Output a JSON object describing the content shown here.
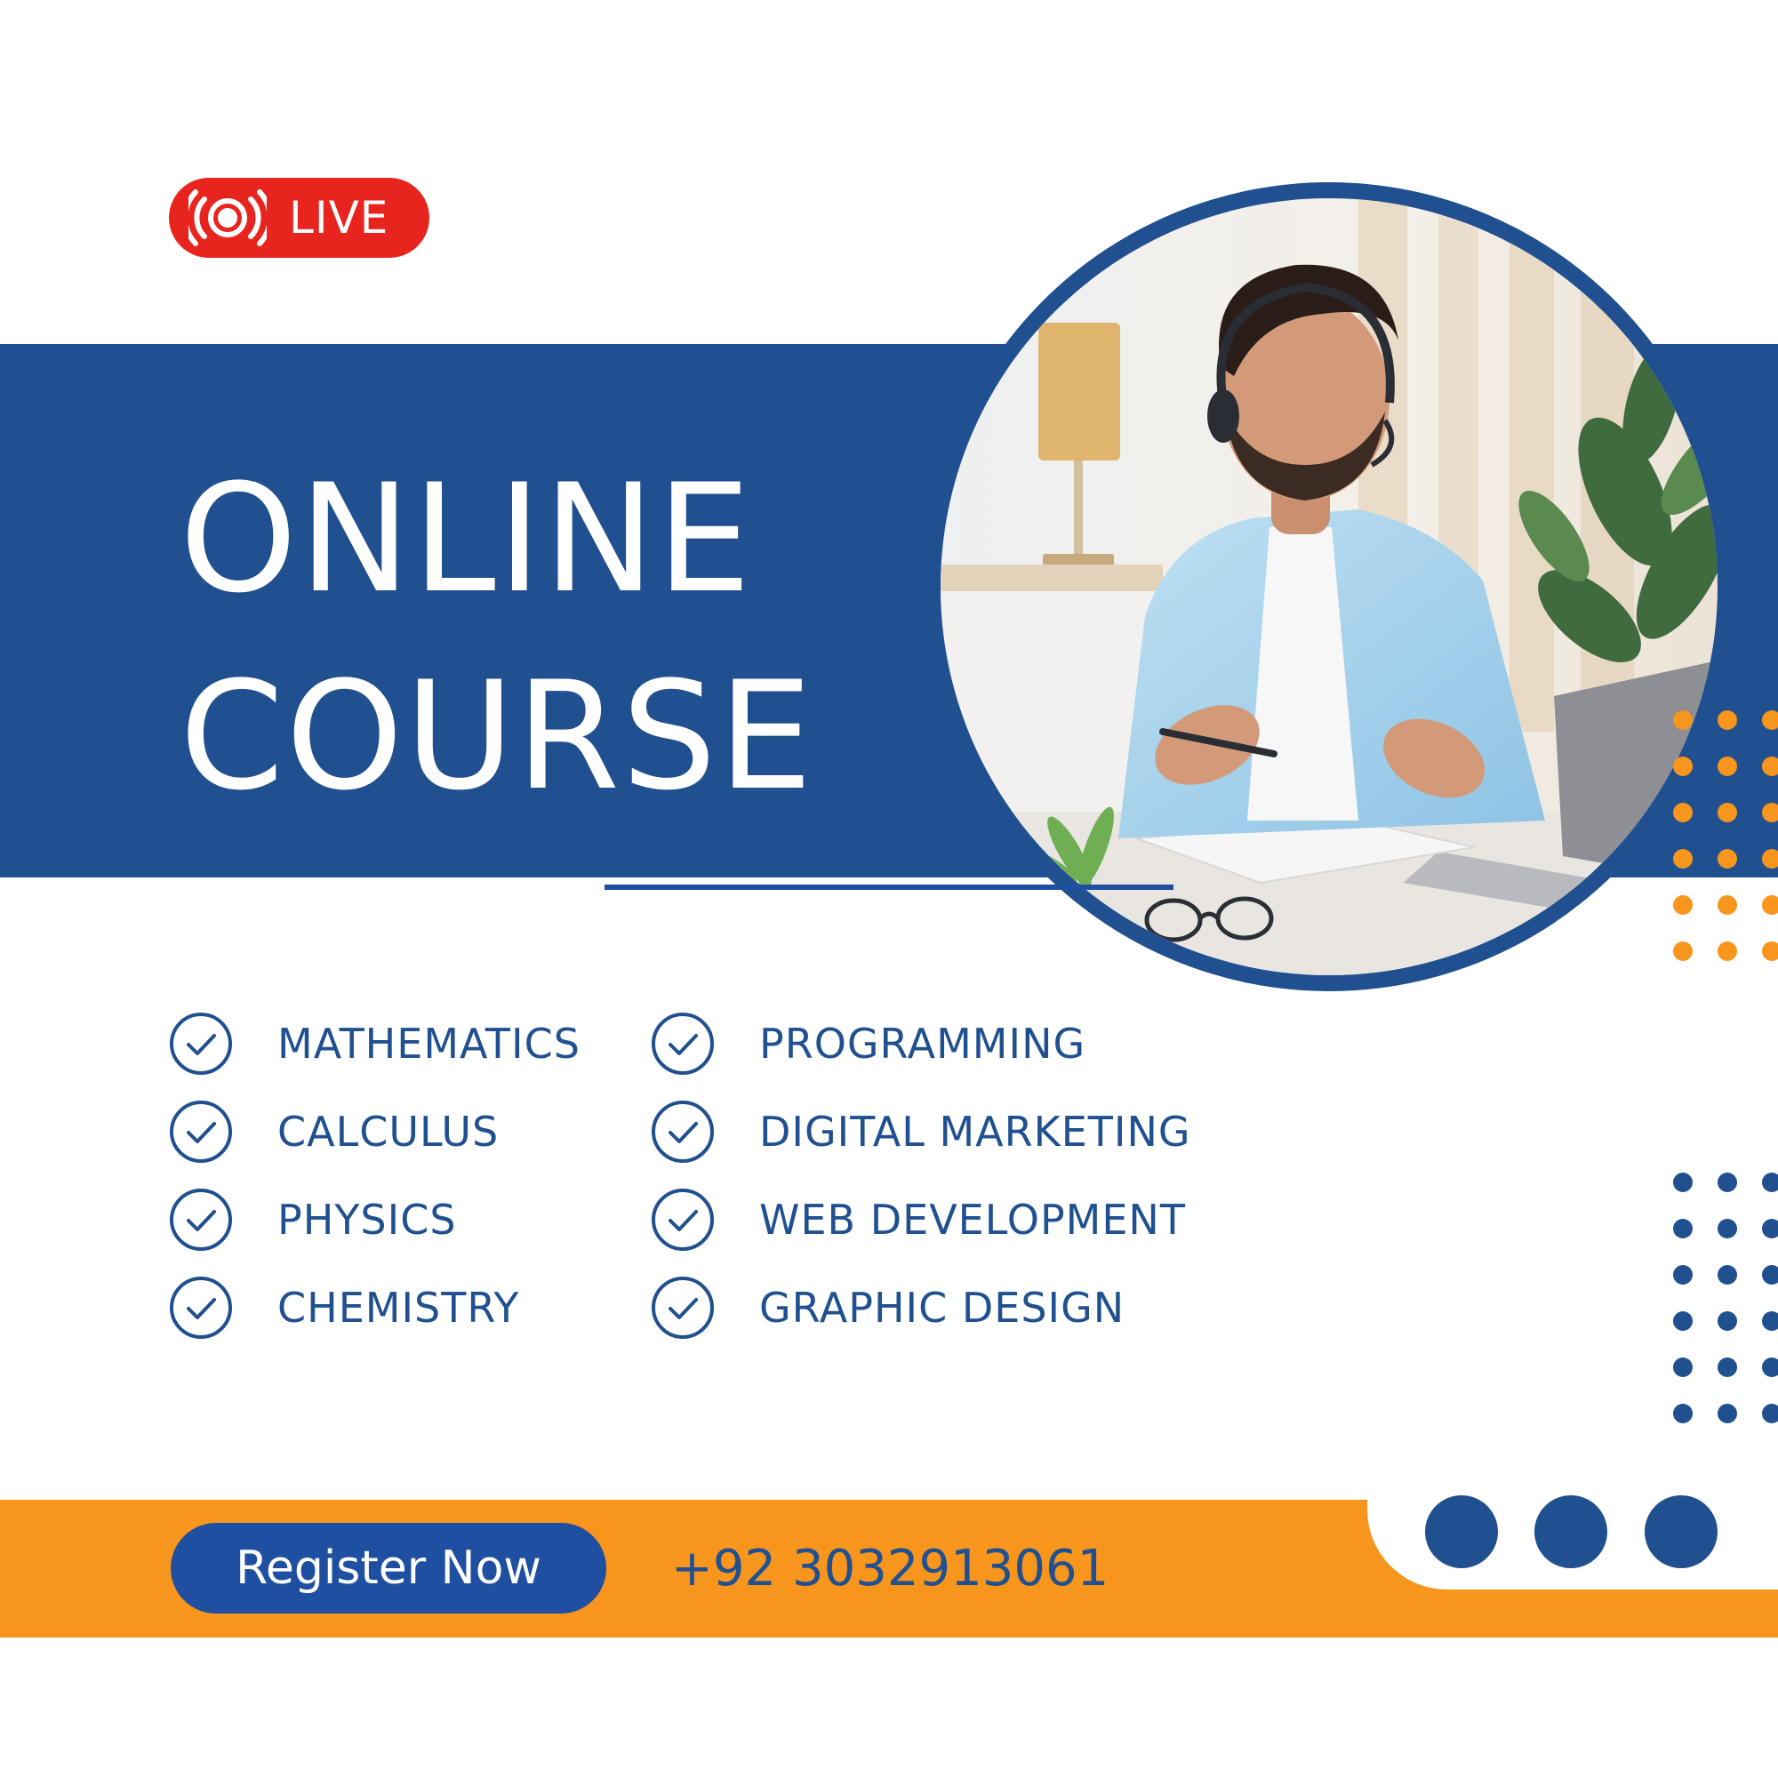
{
  "badge": {
    "label": "LIVE",
    "icon": "live-broadcast-icon",
    "color": "#e8241f"
  },
  "headline": {
    "line1": "ONLINE",
    "line2": "COURSE"
  },
  "photo": {
    "subject": "photo-man-with-headset-at-laptop"
  },
  "courses": {
    "left": [
      "MATHEMATICS",
      "CALCULUS",
      "PHYSICS",
      "CHEMISTRY"
    ],
    "right": [
      "PROGRAMMING",
      "DIGITAL MARKETING",
      "WEB DEVELOPMENT",
      "GRAPHIC DESIGN"
    ],
    "icon": "check-circle-icon"
  },
  "footer": {
    "button_label": "Register Now",
    "phone": "+92 3032913061"
  },
  "colors": {
    "primary": "#20508f",
    "accent": "#f7951d",
    "live": "#e8241f",
    "background": "#ffffff"
  }
}
